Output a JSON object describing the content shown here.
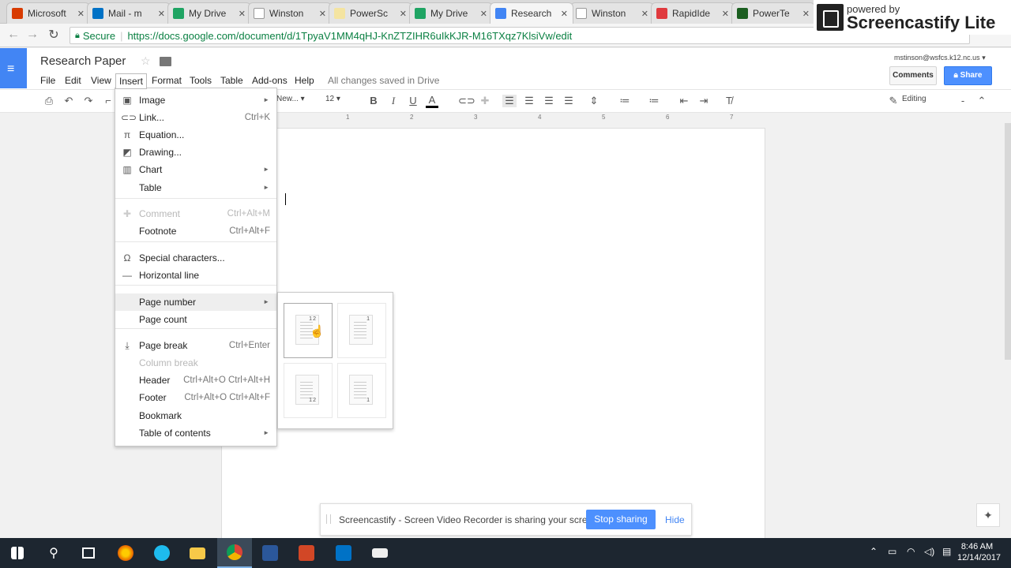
{
  "browser": {
    "tabs": [
      {
        "label": "Microsoft",
        "color": "#d83b01"
      },
      {
        "label": "Mail - m",
        "color": "#0072c6"
      },
      {
        "label": "My Drive",
        "color": "#1fa463"
      },
      {
        "label": "Winston",
        "color": "#ffffff"
      },
      {
        "label": "PowerSc",
        "color": "#f4e4a1"
      },
      {
        "label": "My Drive",
        "color": "#1fa463"
      },
      {
        "label": "Research",
        "color": "#4285f4"
      },
      {
        "label": "Winston",
        "color": "#ffffff"
      },
      {
        "label": "RapidIde",
        "color": "#e03a3e"
      },
      {
        "label": "PowerTe",
        "color": "#1b5e20"
      }
    ],
    "secure_label": "Secure",
    "url": "https://docs.google.com/document/d/1TpyaV1MM4qHJ-KnZTZIHR6uIkKJR-M16TXqz7KlsiVw/edit"
  },
  "screencastify": {
    "powered_by": "powered by",
    "brand": "Screencastify Lite",
    "sharing_message": "Screencastify - Screen Video Recorder is sharing your screen.",
    "stop_label": "Stop sharing",
    "hide_label": "Hide"
  },
  "docs": {
    "title": "Research Paper",
    "menus": [
      "File",
      "Edit",
      "View",
      "Insert",
      "Format",
      "Tools",
      "Table",
      "Add-ons",
      "Help"
    ],
    "save_status": "All changes saved in Drive",
    "user_email": "mstinson@wsfcs.k12.nc.us",
    "comments_label": "Comments",
    "share_label": "Share",
    "font_name": "New...",
    "font_size": "12",
    "mode": "Editing",
    "ruler_numbers": [
      "1",
      "2",
      "3",
      "4",
      "5",
      "6",
      "7"
    ]
  },
  "insert_menu": {
    "items": [
      {
        "label": "Image",
        "icon": "image-icon",
        "shortcut": "",
        "submenu": true,
        "disabled": false
      },
      {
        "label": "Link...",
        "icon": "link-icon",
        "shortcut": "Ctrl+K",
        "submenu": false,
        "disabled": false
      },
      {
        "label": "Equation...",
        "icon": "pi-icon",
        "shortcut": "",
        "submenu": false,
        "disabled": false
      },
      {
        "label": "Drawing...",
        "icon": "drawing-icon",
        "shortcut": "",
        "submenu": false,
        "disabled": false
      },
      {
        "label": "Chart",
        "icon": "chart-icon",
        "shortcut": "",
        "submenu": true,
        "disabled": false
      },
      {
        "label": "Table",
        "icon": "",
        "shortcut": "",
        "submenu": true,
        "disabled": false
      },
      {
        "label": "Comment",
        "icon": "comment-icon",
        "shortcut": "Ctrl+Alt+M",
        "submenu": false,
        "disabled": true
      },
      {
        "label": "Footnote",
        "icon": "",
        "shortcut": "Ctrl+Alt+F",
        "submenu": false,
        "disabled": false
      },
      {
        "label": "Special characters...",
        "icon": "omega-icon",
        "shortcut": "",
        "submenu": false,
        "disabled": false
      },
      {
        "label": "Horizontal line",
        "icon": "horizontal-line-icon",
        "shortcut": "",
        "submenu": false,
        "disabled": false
      },
      {
        "label": "Page number",
        "icon": "",
        "shortcut": "",
        "submenu": true,
        "disabled": false
      },
      {
        "label": "Page count",
        "icon": "",
        "shortcut": "",
        "submenu": false,
        "disabled": false
      },
      {
        "label": "Page break",
        "icon": "page-break-icon",
        "shortcut": "Ctrl+Enter",
        "submenu": false,
        "disabled": false
      },
      {
        "label": "Column break",
        "icon": "",
        "shortcut": "",
        "submenu": false,
        "disabled": true
      },
      {
        "label": "Header",
        "icon": "",
        "shortcut": "Ctrl+Alt+O Ctrl+Alt+H",
        "submenu": false,
        "disabled": false
      },
      {
        "label": "Footer",
        "icon": "",
        "shortcut": "Ctrl+Alt+O Ctrl+Alt+F",
        "submenu": false,
        "disabled": false
      },
      {
        "label": "Bookmark",
        "icon": "",
        "shortcut": "",
        "submenu": false,
        "disabled": false
      },
      {
        "label": "Table of contents",
        "icon": "",
        "shortcut": "",
        "submenu": true,
        "disabled": false
      }
    ],
    "highlighted": "Page number"
  },
  "page_number_submenu": {
    "options": [
      {
        "numbers": [
          "1",
          "2"
        ],
        "selected": true
      },
      {
        "numbers": [
          "1"
        ],
        "selected": false
      },
      {
        "numbers": [
          "1",
          "2"
        ],
        "selected": false
      },
      {
        "numbers": [
          "1"
        ],
        "selected": false
      }
    ]
  },
  "taskbar": {
    "time": "8:46 AM",
    "date": "12/14/2017"
  }
}
